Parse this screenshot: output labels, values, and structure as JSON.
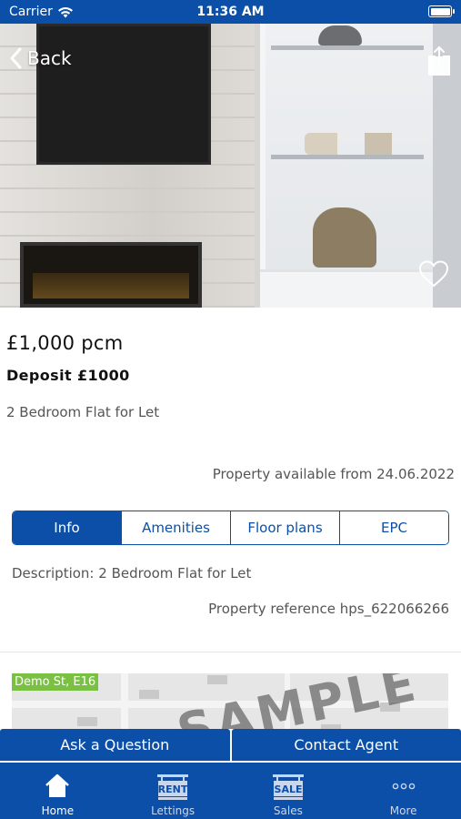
{
  "status_bar": {
    "carrier": "Carrier",
    "time": "11:36 AM"
  },
  "header": {
    "back_label": "Back"
  },
  "listing": {
    "price": "£1,000 pcm",
    "deposit": "Deposit £1000",
    "subtitle": "2 Bedroom Flat for Let",
    "available": "Property available from 24.06.2022"
  },
  "tabs": [
    {
      "label": "Info",
      "active": true
    },
    {
      "label": "Amenities",
      "active": false
    },
    {
      "label": "Floor plans",
      "active": false
    },
    {
      "label": "EPC",
      "active": false
    }
  ],
  "info": {
    "description": "Description: 2 Bedroom Flat for Let",
    "reference": "Property reference hps_622066266"
  },
  "map": {
    "location_label": "Demo St, E16",
    "watermark": "SAMPLE"
  },
  "actions": {
    "ask_question": "Ask a Question",
    "contact_agent": "Contact Agent"
  },
  "bottom_nav": {
    "items": [
      {
        "label": "Home",
        "icon": "home-icon",
        "active": true
      },
      {
        "label": "Lettings",
        "icon": "rent-sign-icon",
        "active": false
      },
      {
        "label": "Sales",
        "icon": "sale-sign-icon",
        "active": false
      },
      {
        "label": "More",
        "icon": "more-dots-icon",
        "active": false
      }
    ],
    "rent_sign_text": "RENT",
    "sale_sign_text": "SALE"
  },
  "colors": {
    "brand_blue": "#0b4fa8",
    "map_label_green": "#7ac143"
  }
}
